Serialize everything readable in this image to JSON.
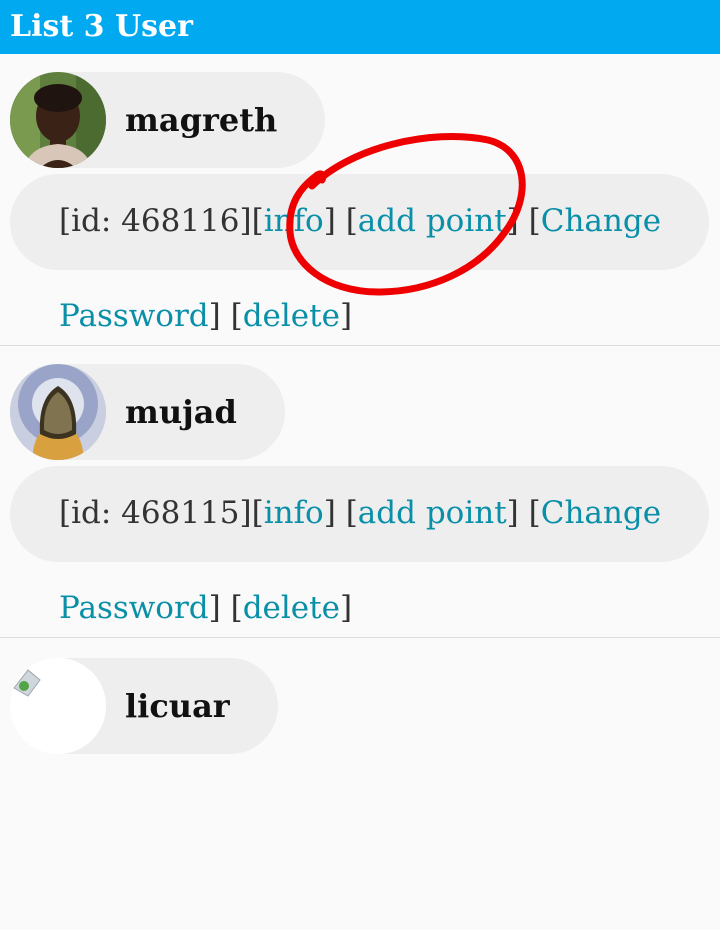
{
  "header": {
    "title": "List 3 User"
  },
  "users": [
    {
      "name": "magreth",
      "id_text": "[id: 468116]",
      "open1": "[",
      "info": "info",
      "close1": "]",
      "open2": " [",
      "add_point": "add point",
      "close2": "]",
      "open3": " [",
      "change_password": "Change Password",
      "close3": "]",
      "open4": " [",
      "delete": "delete",
      "close4": "]"
    },
    {
      "name": "mujad",
      "id_text": "[id: 468115]",
      "open1": "[",
      "info": "info",
      "close1": "]",
      "open2": " [",
      "add_point": "add point",
      "close2": "]",
      "open3": " [",
      "change_password": "Change Password",
      "close3": "]",
      "open4": " [",
      "delete": "delete",
      "close4": "]"
    },
    {
      "name": "licuar"
    }
  ],
  "colors": {
    "header_bg": "#00a9f0",
    "link": "#0a8fa8",
    "annotation": "#ee0000"
  }
}
